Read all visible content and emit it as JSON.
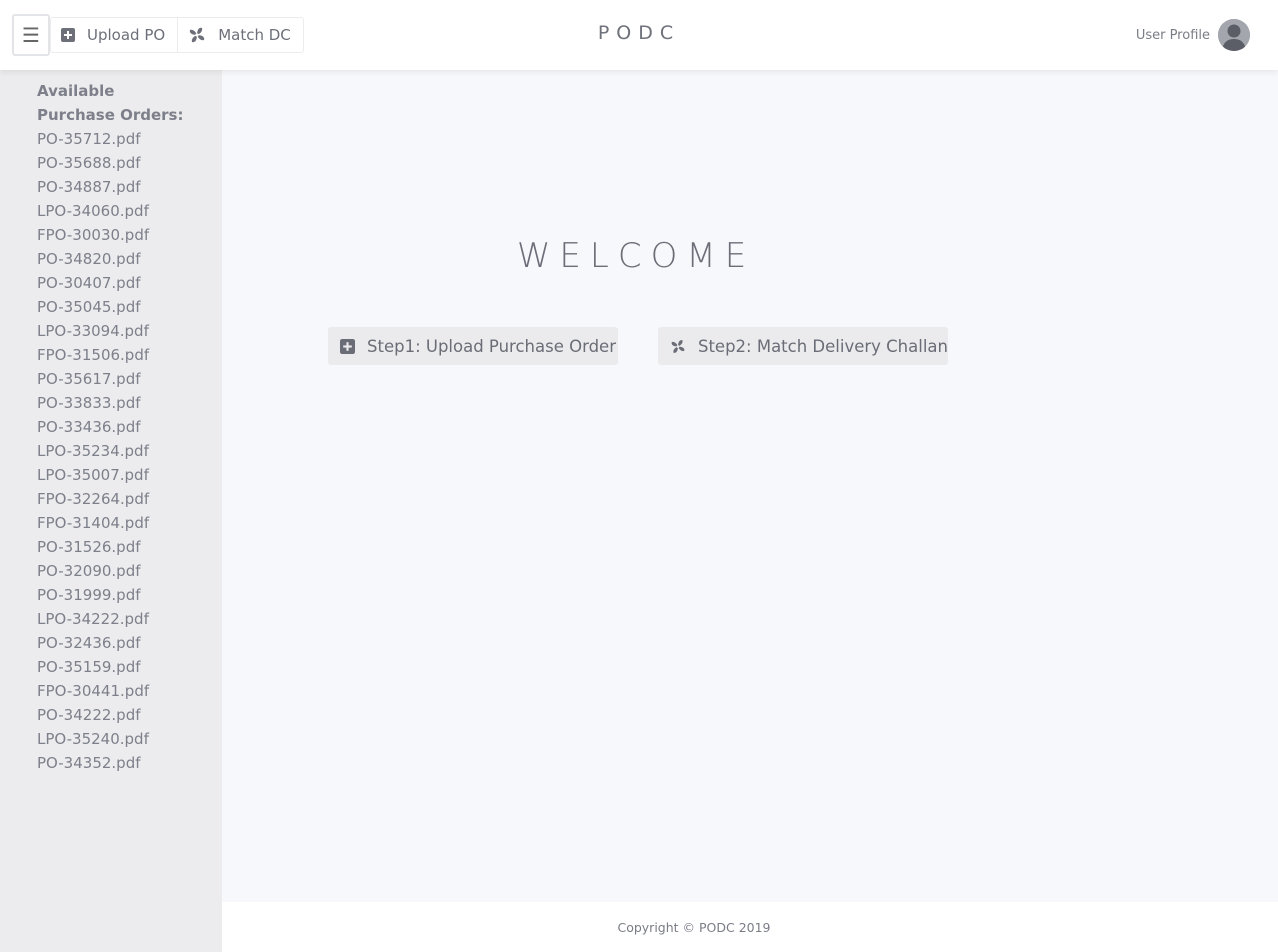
{
  "topbar": {
    "menu_icon_glyph": "☰",
    "nav": [
      {
        "label": "Upload PO",
        "icon": "plus-square-icon"
      },
      {
        "label": "Match DC",
        "icon": "fan-icon"
      }
    ],
    "brand": "PODC",
    "profile_label": "User Profile"
  },
  "sidebar": {
    "heading": "Available Purchase Orders:",
    "items": [
      "PO-35712.pdf",
      "PO-35688.pdf",
      "PO-34887.pdf",
      "LPO-34060.pdf",
      "FPO-30030.pdf",
      "PO-34820.pdf",
      "PO-30407.pdf",
      "PO-35045.pdf",
      "LPO-33094.pdf",
      "FPO-31506.pdf",
      "PO-35617.pdf",
      "PO-33833.pdf",
      "PO-33436.pdf",
      "LPO-35234.pdf",
      "LPO-35007.pdf",
      "FPO-32264.pdf",
      "FPO-31404.pdf",
      "PO-31526.pdf",
      "PO-32090.pdf",
      "PO-31999.pdf",
      "LPO-34222.pdf",
      "PO-32436.pdf",
      "PO-35159.pdf",
      "FPO-30441.pdf",
      "PO-34222.pdf",
      "LPO-35240.pdf",
      "PO-34352.pdf"
    ]
  },
  "main": {
    "welcome": "WELCOME",
    "step1_label": "Step1: Upload Purchase Order",
    "step2_label": "Step2: Match Delivery Challan"
  },
  "footer": {
    "copyright": "Copyright © PODC 2019"
  },
  "colors": {
    "topbar_bg": "#ffffff",
    "sidebar_bg": "#ececee",
    "content_bg": "#f7f8fb",
    "text": "#7d808a",
    "button_bg": "#ebebed"
  }
}
